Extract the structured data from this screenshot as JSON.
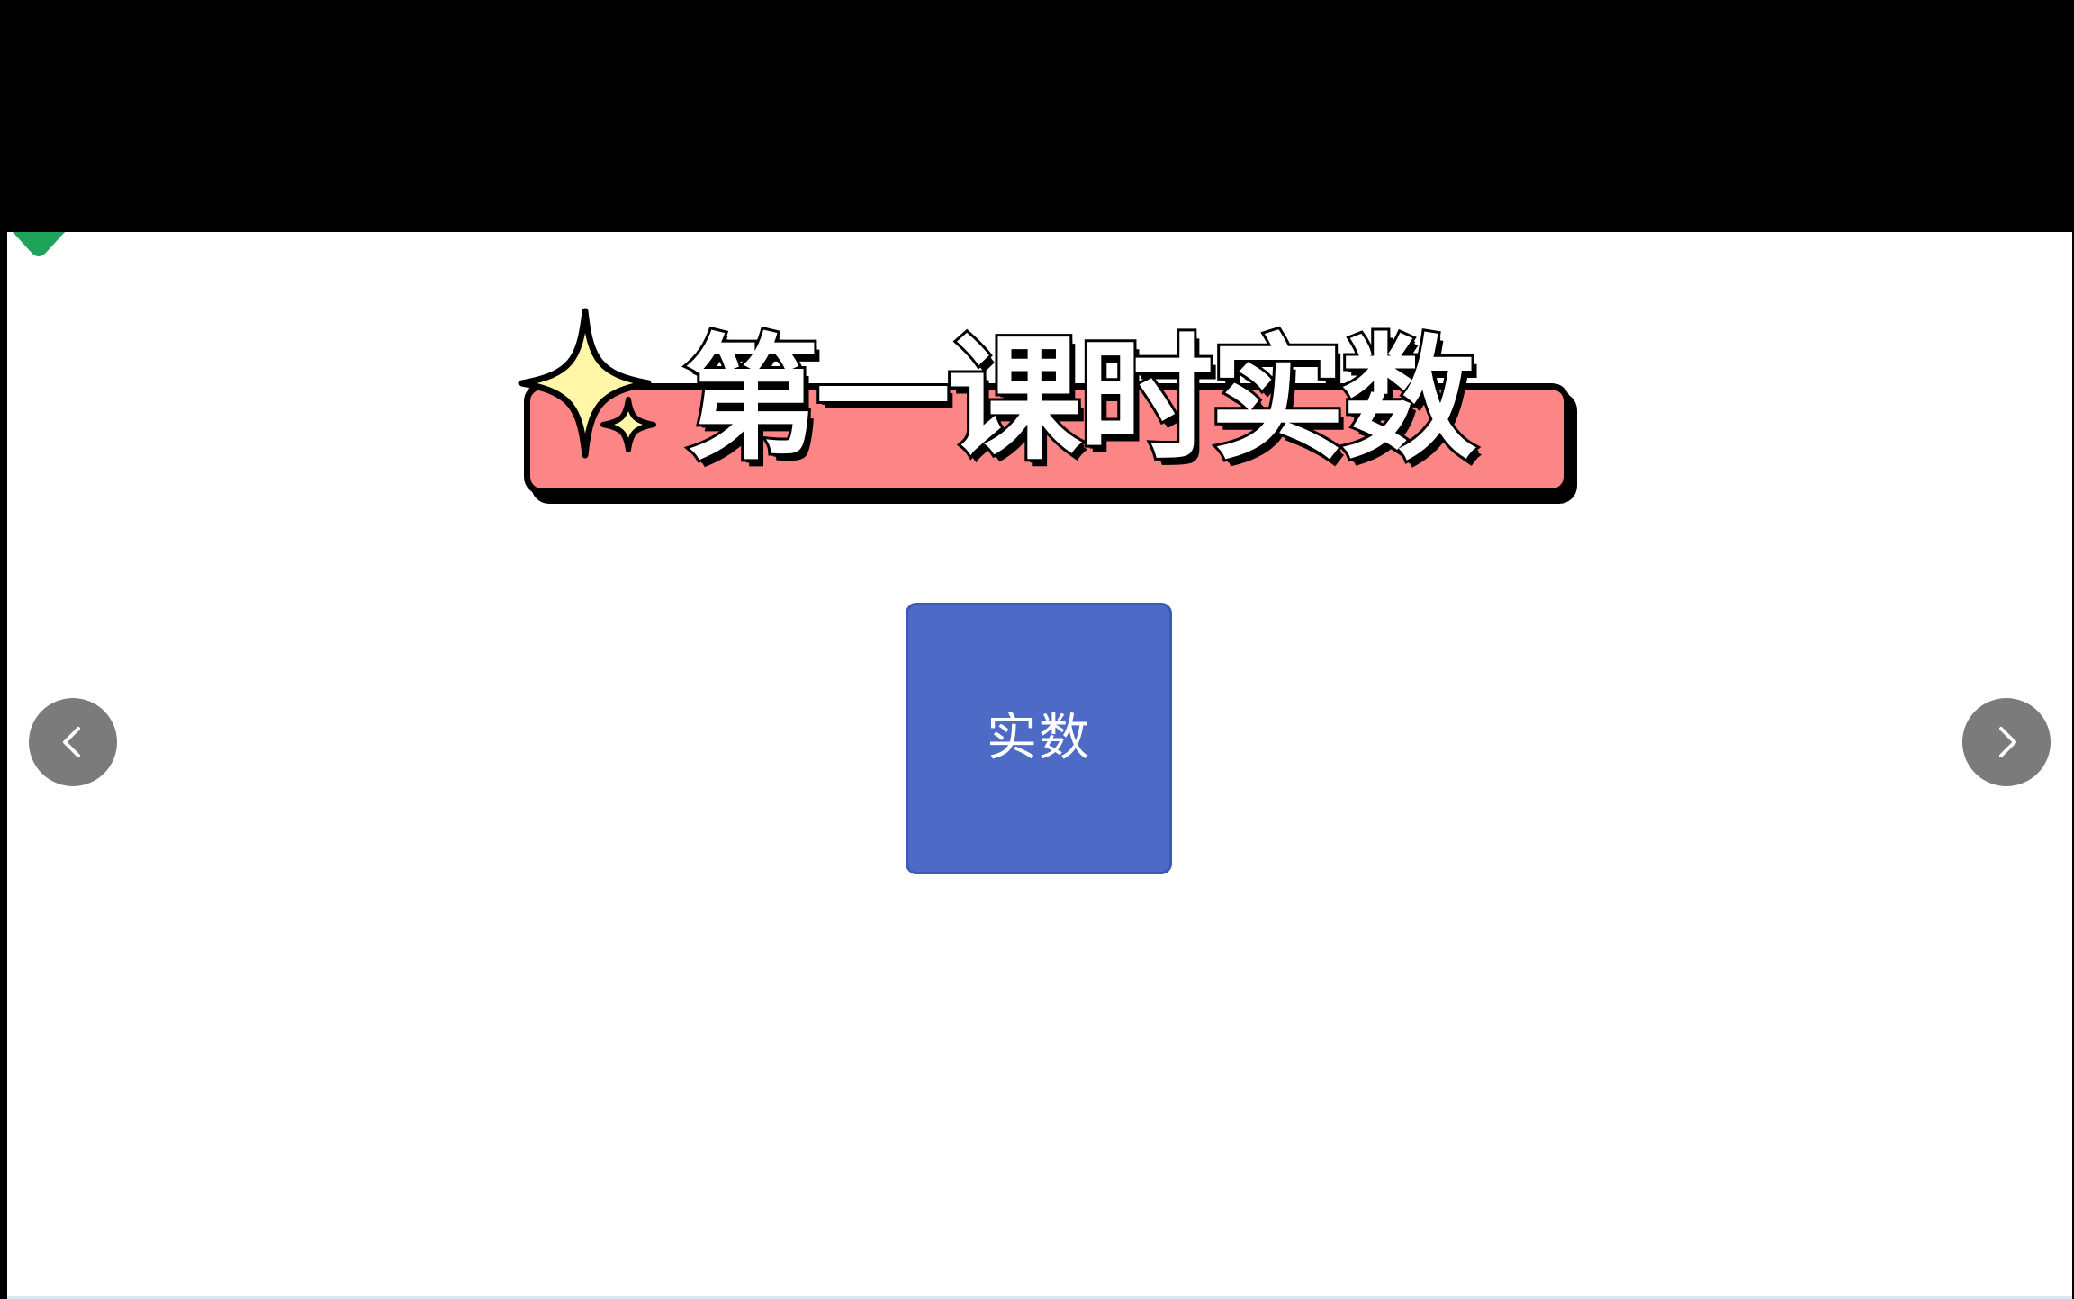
{
  "slide": {
    "title": "第一课时实数",
    "topic_label": "实数"
  },
  "navigation": {
    "prev_icon": "chevron-left-icon",
    "next_icon": "chevron-right-icon"
  },
  "colors": {
    "background": "#ffffff",
    "letterbox": "#000000",
    "title_banner": "#fc8686",
    "title_outline": "#000000",
    "sparkle_fill": "#fff6a8",
    "topic_card": "#4d6bc6",
    "nav_button": "#7b7b7b",
    "corner_marker": "#1fa35a"
  }
}
